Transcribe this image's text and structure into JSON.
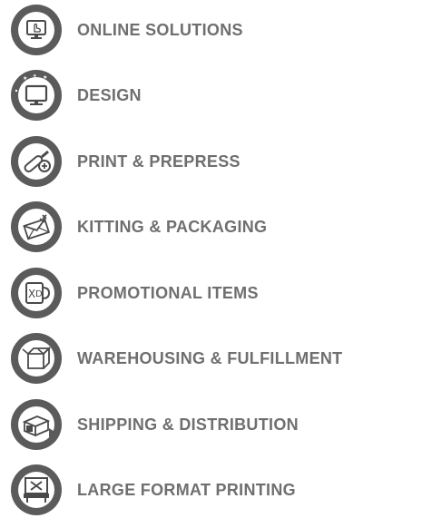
{
  "theme": {
    "ring_color": "#5b5b5b",
    "inner_color": "#ffffff",
    "icon_color": "#4a4a4a",
    "label_color": "#6f6f6f"
  },
  "services": [
    {
      "label": "ONLINE SOLUTIONS",
      "icon": "touch-monitor-icon"
    },
    {
      "label": "DESIGN",
      "icon": "design-monitor-icon"
    },
    {
      "label": "PRINT & PREPRESS",
      "icon": "print-roller-icon"
    },
    {
      "label": "KITTING & PACKAGING",
      "icon": "envelope-kit-icon"
    },
    {
      "label": "PROMOTIONAL ITEMS",
      "icon": "mug-icon"
    },
    {
      "label": "WAREHOUSING  & FULFILLMENT",
      "icon": "box-icon"
    },
    {
      "label": "SHIPPING & DISTRIBUTION",
      "icon": "package-truck-icon"
    },
    {
      "label": "LARGE FORMAT PRINTING",
      "icon": "large-printer-icon"
    }
  ]
}
